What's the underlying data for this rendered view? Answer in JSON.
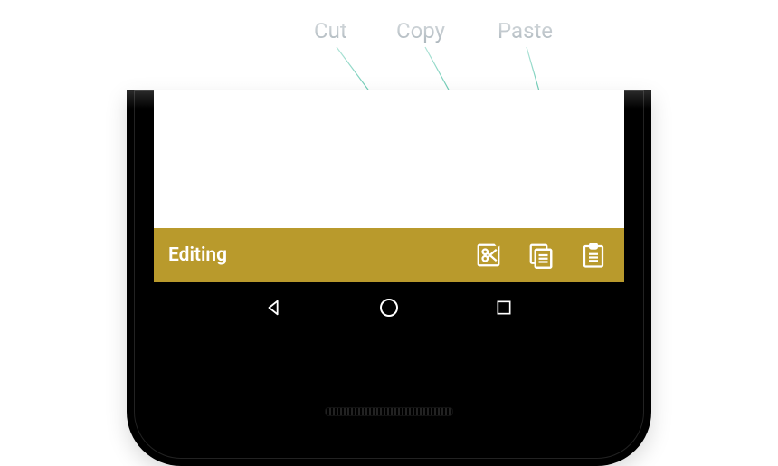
{
  "callouts": {
    "cut": "Cut",
    "copy": "Copy",
    "paste": "Paste"
  },
  "toolbar": {
    "title": "Editing",
    "cut_name": "cut-icon",
    "copy_name": "copy-icon",
    "paste_name": "paste-icon"
  },
  "nav": {
    "back": "back-button",
    "home": "home-button",
    "recent": "overview-button"
  },
  "colors": {
    "toolbar_bg": "#b99a2c",
    "callout_line": "#4fc1a6",
    "callout_text": "#2f4858"
  }
}
